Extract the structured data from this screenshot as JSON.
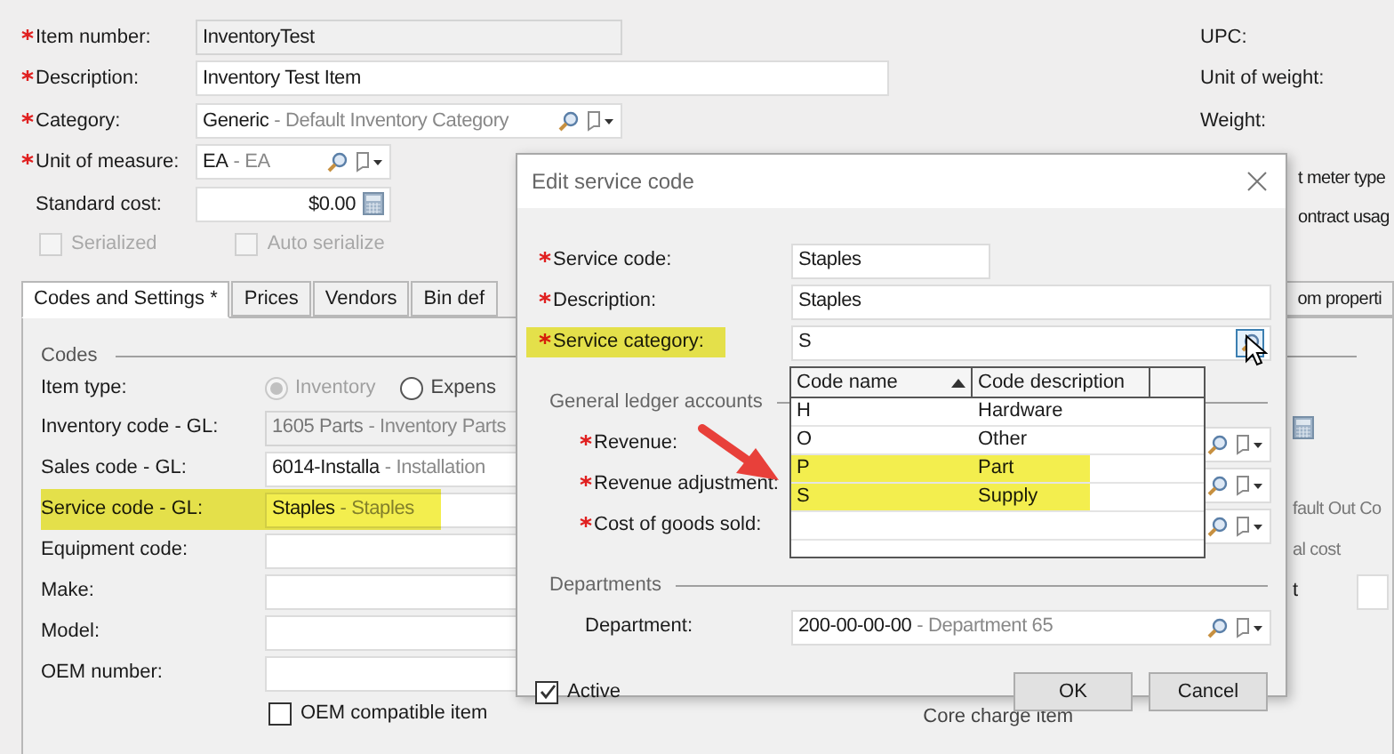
{
  "item": {
    "fields": [
      {
        "label": "Item number:",
        "required": true,
        "kind": "readonly",
        "value": "InventoryTest"
      },
      {
        "label": "Description:",
        "required": true,
        "kind": "text",
        "value": "Inventory Test Item"
      },
      {
        "label": "Category:",
        "required": true,
        "kind": "lookup",
        "value": "Generic",
        "description": "- Default Inventory Category"
      },
      {
        "label": "Unit of measure:",
        "required": true,
        "kind": "lookup",
        "value": "EA",
        "description": "- EA"
      },
      {
        "label": "Standard cost:",
        "required": false,
        "kind": "currency",
        "value": "$0.00"
      }
    ],
    "checkboxes": [
      {
        "label": "Serialized",
        "checked": false,
        "disabled": true
      },
      {
        "label": "Auto serialize",
        "checked": false,
        "disabled": true
      }
    ],
    "right_labels": [
      "UPC:",
      "Unit of weight:",
      "Weight:"
    ],
    "right_partial": [
      "t meter type",
      "ontract usag"
    ]
  },
  "tabs": [
    {
      "label": "Codes and Settings *",
      "selected": true
    },
    {
      "label": "Prices",
      "selected": false
    },
    {
      "label": "Vendors",
      "selected": false
    },
    {
      "label": "Bin def",
      "selected": false
    },
    {
      "label": "om properti",
      "selected": false
    }
  ],
  "codes": {
    "legend": "Codes",
    "item_type": {
      "label": "Item type:",
      "options": [
        {
          "label": "Inventory",
          "selected": true,
          "disabled": true
        },
        {
          "label": "Expens",
          "selected": false,
          "disabled": false
        }
      ]
    },
    "rows": [
      {
        "label": "Inventory code - GL:",
        "kind": "disabled",
        "value": "1605 Parts",
        "description": "- Inventory Parts",
        "highlighted": false,
        "right": {
          "kind": "calculator"
        }
      },
      {
        "label": "Sales code - GL:",
        "kind": "lookup",
        "value": "6014-Installa",
        "description": "- Installation",
        "highlighted": false
      },
      {
        "label": "Service code - GL:",
        "kind": "lookup",
        "value": "Staples",
        "description": "- Staples",
        "highlighted": true,
        "right": {
          "kind": "text",
          "text": "fault Out Co"
        }
      },
      {
        "label": "Equipment code:",
        "kind": "text",
        "highlighted": false,
        "right": {
          "kind": "text",
          "text": "al cost"
        }
      },
      {
        "label": "Make:",
        "kind": "text",
        "highlighted": false,
        "right": {
          "kind": "input",
          "text": "t"
        }
      },
      {
        "label": "Model:",
        "kind": "text",
        "highlighted": false
      },
      {
        "label": "OEM number:",
        "kind": "text",
        "highlighted": false
      }
    ],
    "oem": {
      "label": "OEM compatible item",
      "checked": false
    },
    "core_charge": "Core charge item"
  },
  "dialog": {
    "title": "Edit service code",
    "service_code": {
      "label": "Service code:",
      "required": true,
      "value": "Staples",
      "highlighted": false
    },
    "description": {
      "label": "Description:",
      "required": true,
      "value": "Staples",
      "highlighted": false
    },
    "service_category": {
      "label": "Service category:",
      "required": true,
      "value": "S",
      "highlighted": true
    },
    "gl_legend": "General ledger accounts",
    "gl_rows": [
      {
        "label": "Revenue:",
        "required": true
      },
      {
        "label": "Revenue adjustment:",
        "required": true
      },
      {
        "label": "Cost of goods sold:",
        "required": true
      }
    ],
    "departments_legend": "Departments",
    "department": {
      "label": "Department:",
      "required": false,
      "value": "200-00-00-00",
      "description": "- Department 65",
      "highlighted": false
    },
    "active": {
      "label": "Active",
      "checked": true
    },
    "buttons": [
      "OK",
      "Cancel"
    ],
    "dropdown": {
      "columns": [
        "Code name",
        "Code description"
      ],
      "rows": [
        {
          "code": "H",
          "description": "Hardware",
          "highlighted": false
        },
        {
          "code": "O",
          "description": "Other",
          "highlighted": false
        },
        {
          "code": "P",
          "description": "Part",
          "highlighted": true
        },
        {
          "code": "S",
          "description": "Supply",
          "highlighted": true
        }
      ]
    }
  }
}
